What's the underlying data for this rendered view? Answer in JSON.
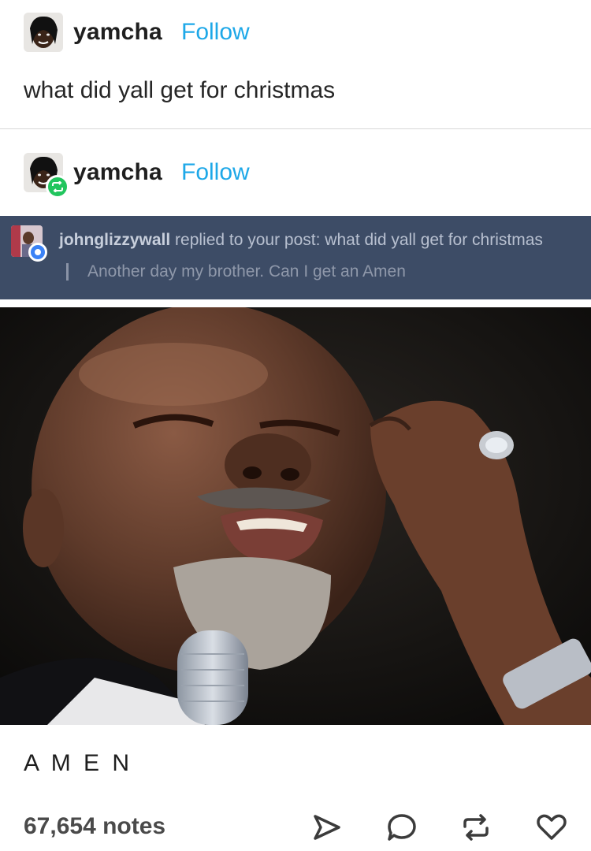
{
  "post1": {
    "username": "yamcha",
    "follow_label": "Follow",
    "text": "what did yall get for christmas"
  },
  "post2": {
    "username": "yamcha",
    "follow_label": "Follow"
  },
  "reply": {
    "username": "johnglizzywall",
    "action_text": " replied to your post:  what did yall get for christmas",
    "quote": "Another day my brother. Can I get an Amen"
  },
  "caption": "A M E N",
  "footer": {
    "notes": "67,654 notes"
  },
  "icons": {
    "share": "share-icon",
    "reply": "reply-icon",
    "reblog": "reblog-icon",
    "like": "heart-icon"
  },
  "colors": {
    "follow": "#1ea8e8",
    "reply_banner": "#3d4c66",
    "reblog_badge": "#22c55e"
  }
}
